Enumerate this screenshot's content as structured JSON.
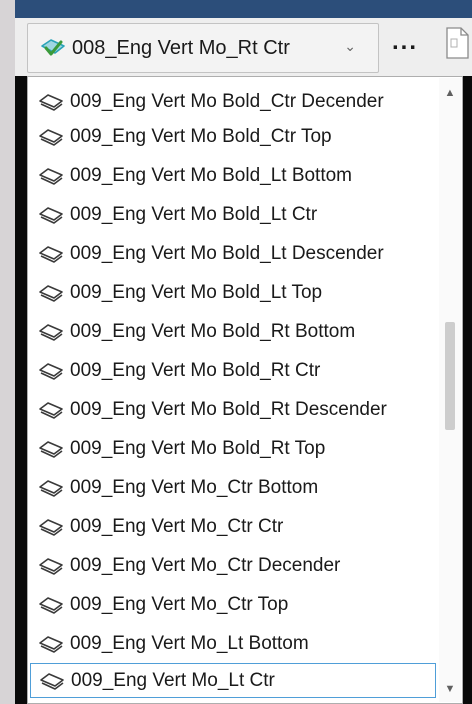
{
  "combo": {
    "selected_label": "008_Eng Vert Mo_Rt Ctr",
    "selected_icon": "checked-text-style-icon",
    "caret": "⌄"
  },
  "toolbar": {
    "more_label": "...",
    "doc_icon": "document-icon"
  },
  "dropdown": {
    "item_icon": "text-style-icon",
    "items": [
      "009_Eng Vert Mo Bold_Ctr Decender",
      "009_Eng Vert Mo Bold_Ctr Top",
      "009_Eng Vert Mo Bold_Lt Bottom",
      "009_Eng Vert Mo Bold_Lt Ctr",
      "009_Eng Vert Mo Bold_Lt Descender",
      "009_Eng Vert Mo Bold_Lt Top",
      "009_Eng Vert Mo Bold_Rt Bottom",
      "009_Eng Vert Mo Bold_Rt Ctr",
      "009_Eng Vert Mo Bold_Rt Descender",
      "009_Eng Vert Mo Bold_Rt Top",
      "009_Eng Vert Mo_Ctr Bottom",
      "009_Eng Vert Mo_Ctr Ctr",
      "009_Eng Vert Mo_Ctr Decender",
      "009_Eng Vert Mo_Ctr Top",
      "009_Eng Vert Mo_Lt Bottom",
      "009_Eng Vert Mo_Lt Ctr"
    ],
    "focused_item": "009_Eng Vert Mo_Lt Ctr"
  },
  "scrollbar": {
    "up_arrow": "▲",
    "down_arrow": "▼",
    "colors": {
      "thumb": "#cdcdcd",
      "track": "#fafafa"
    }
  },
  "colors": {
    "title_bar": "#2c4e7a",
    "focus_border": "#4f9ed8",
    "icon_teal": "#2aa3b8",
    "icon_check": "#3a9a3a"
  }
}
